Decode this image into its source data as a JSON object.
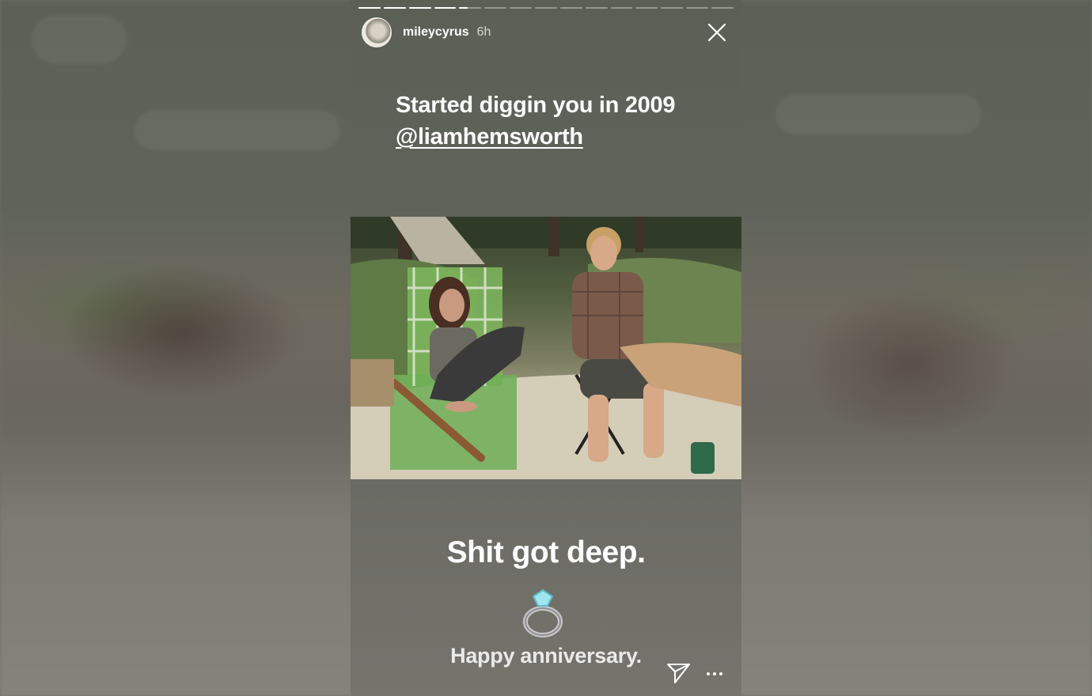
{
  "story": {
    "username": "mileycyrus",
    "time_ago": "6h",
    "progress": {
      "segments": 15,
      "completed": 4,
      "current_fraction": 0.4
    },
    "headline_line1": "Started diggin you in 2009",
    "mention": "@liamhemsworth",
    "caption": "Shit got deep.",
    "emoji": "💍",
    "subcaption": "Happy anniversary."
  },
  "icons": {
    "close": "close-icon",
    "send": "send-icon",
    "more": "more-icon",
    "avatar": "avatar"
  },
  "colors": {
    "panel_bg": "#60645a",
    "text": "#ffffff"
  }
}
